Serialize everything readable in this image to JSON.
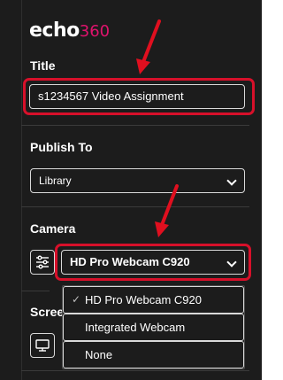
{
  "logo": {
    "brand": "echo",
    "number": "360"
  },
  "title_section": {
    "label": "Title",
    "value": "s1234567 Video Assignment"
  },
  "publish_section": {
    "label": "Publish To",
    "selected": "Library"
  },
  "camera_section": {
    "label": "Camera",
    "selected": "HD Pro Webcam C920",
    "options": [
      "HD Pro Webcam C920",
      "Integrated Webcam",
      "None"
    ]
  },
  "screen_section": {
    "label": "Scree"
  },
  "colors": {
    "panel_bg": "#1c1c1c",
    "highlight": "#d7102a",
    "brand_accent": "#e0136d"
  },
  "icons": {
    "settings": "sliders-icon",
    "screen": "monitor-icon",
    "check": "check-icon"
  }
}
